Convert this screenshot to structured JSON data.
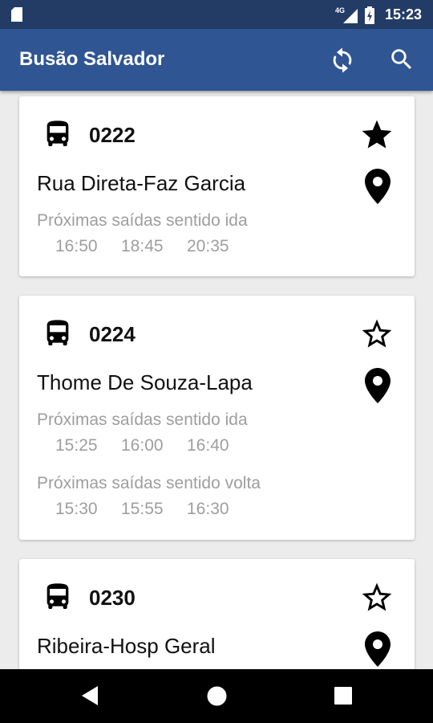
{
  "status_bar": {
    "time": "15:23",
    "network": "4G"
  },
  "app_bar": {
    "title": "Busão Salvador"
  },
  "icons": {
    "refresh": "refresh-icon",
    "search": "search-icon",
    "bus": "bus-icon",
    "star": "star-icon",
    "pin": "location-pin-icon"
  },
  "colors": {
    "status_bar": "#233c66",
    "app_bar": "#2f5593",
    "muted_text": "#9e9e9e"
  },
  "cards": [
    {
      "number": "0222",
      "route": "Rua Direta-Faz Garcia",
      "favorite": true,
      "departures_ida_label": "Próximas saídas sentido ida",
      "departures_ida": [
        "16:50",
        "18:45",
        "20:35"
      ]
    },
    {
      "number": "0224",
      "route": "Thome De Souza-Lapa",
      "favorite": false,
      "departures_ida_label": "Próximas saídas sentido ida",
      "departures_ida": [
        "15:25",
        "16:00",
        "16:40"
      ],
      "departures_volta_label": "Próximas saídas sentido volta",
      "departures_volta": [
        "15:30",
        "15:55",
        "16:30"
      ]
    },
    {
      "number": "0230",
      "route": "Ribeira-Hosp Geral",
      "favorite": false
    }
  ]
}
